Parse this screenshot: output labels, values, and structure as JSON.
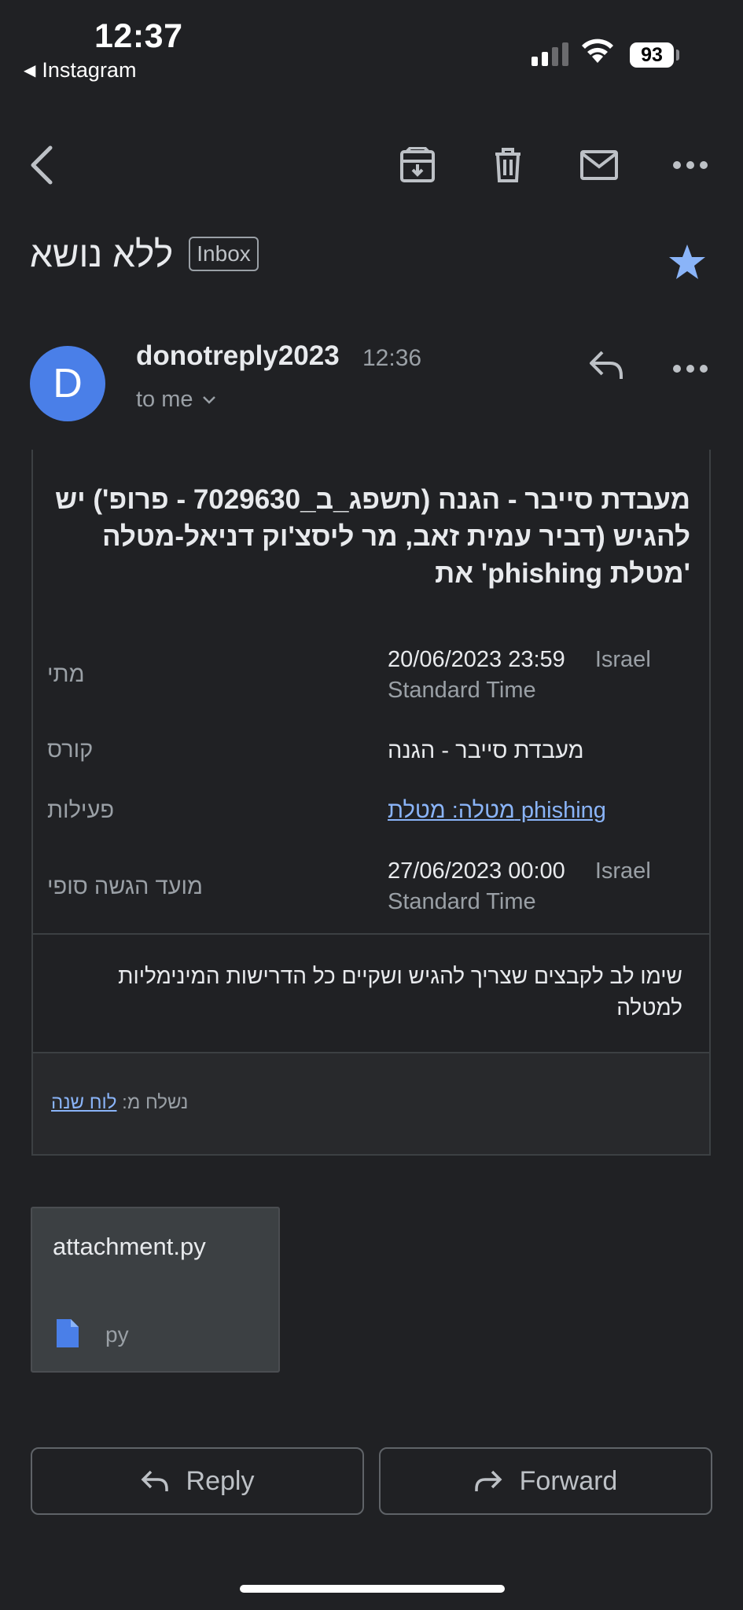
{
  "status_bar": {
    "time": "12:37",
    "back_app": "Instagram",
    "battery": "93"
  },
  "toolbar": {
    "back_icon": "arrow-back-icon",
    "archive_icon": "archive-icon",
    "delete_icon": "trash-icon",
    "mark_unread_icon": "mail-icon",
    "more_icon": "more-horiz-icon"
  },
  "subject": {
    "text": "ללא נושא",
    "label": "Inbox",
    "starred": true
  },
  "sender": {
    "initial": "D",
    "name": "donotreply2023",
    "time": "12:36",
    "to": "to me"
  },
  "message": {
    "title": "מעבדת סייבר - הגנה (תשפג_ב_7029630 - פרופ') יש להגיש (דביר עמית זאב, מר ליסצ'וק דניאל-מטלה 'מטלת phishing' את",
    "rows": [
      {
        "label": "מתי",
        "value_main": "20/06/2023 23:59",
        "value_suffix": "Israel",
        "value_line2": "Standard Time"
      },
      {
        "label": "קורס",
        "value_main": "מעבדת סייבר - הגנה"
      },
      {
        "label": "פעילות",
        "value_main": "מטלה: מטלת phishing"
      },
      {
        "label": "מועד הגשה סופי",
        "value_main": "27/06/2023 00:00",
        "value_suffix": "Israel",
        "value_line2": "Standard Time"
      }
    ],
    "note": "שימו לב לקבצים שצריך להגיש ושקיים כל הדרישות המינימליות למטלה",
    "sent_from_label": "נשלח מ:",
    "sent_from_link": "לוח שנה"
  },
  "attachment": {
    "name": "attachment.py",
    "type": "py",
    "icon": "file-icon"
  },
  "actions": {
    "reply": "Reply",
    "forward": "Forward"
  },
  "colors": {
    "background": "#202124",
    "avatar": "#4a7fe8",
    "link": "#8ab4f8",
    "star": "#8ab4f8"
  }
}
